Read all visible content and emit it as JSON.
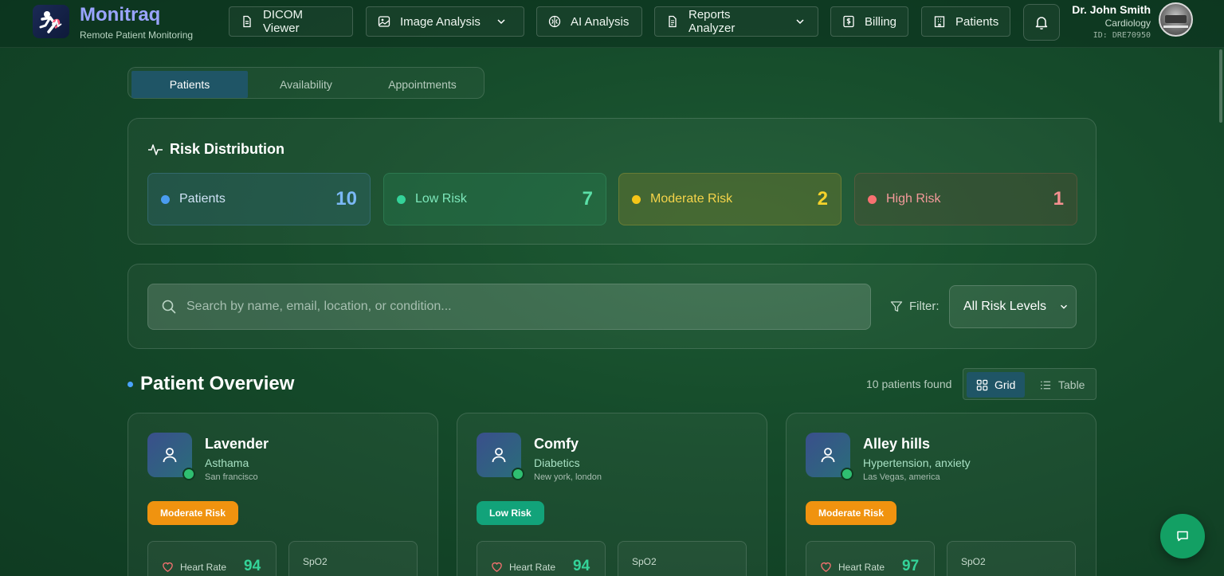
{
  "brand": {
    "title": "Monitraq",
    "subtitle": "Remote Patient Monitoring"
  },
  "nav": [
    {
      "label": "DICOM Viewer",
      "icon": "document-icon"
    },
    {
      "label": "Image Analysis",
      "icon": "image-icon"
    },
    {
      "label": "AI Analysis",
      "icon": "brain-icon"
    },
    {
      "label": "Reports Analyzer",
      "icon": "report-icon"
    },
    {
      "label": "Billing",
      "icon": "dollar-icon"
    },
    {
      "label": "Patients",
      "icon": "hospital-icon"
    }
  ],
  "user": {
    "name": "Dr. John Smith",
    "department": "Cardiology",
    "id": "ID: DRE70950"
  },
  "tabs": [
    "Patients",
    "Availability",
    "Appointments"
  ],
  "risk": {
    "title": "Risk Distribution",
    "cards": [
      {
        "label": "Patients",
        "value": "10",
        "color": "#4a9cf0"
      },
      {
        "label": "Low Risk",
        "value": "7",
        "color": "#34d399"
      },
      {
        "label": "Moderate Risk",
        "value": "2",
        "color": "#f5c518"
      },
      {
        "label": "High Risk",
        "value": "1",
        "color": "#f87171"
      }
    ]
  },
  "search": {
    "placeholder": "Search by name, email, location, or condition..."
  },
  "filter": {
    "label": "Filter:",
    "selected": "All Risk Levels"
  },
  "overview": {
    "title": "Patient Overview",
    "count": "10 patients found",
    "grid_label": "Grid",
    "table_label": "Table"
  },
  "patients": [
    {
      "name": "Lavender",
      "condition": "Asthama",
      "location": "San francisco",
      "risk": "Moderate Risk",
      "heart_rate_label": "Heart Rate",
      "heart_rate": "94",
      "spo2_label": "SpO2"
    },
    {
      "name": "Comfy",
      "condition": "Diabetics",
      "location": "New york, london",
      "risk": "Low Risk",
      "heart_rate_label": "Heart Rate",
      "heart_rate": "94",
      "spo2_label": "SpO2"
    },
    {
      "name": "Alley hills",
      "condition": "Hypertension, anxiety",
      "location": "Las Vegas, america",
      "risk": "Moderate Risk",
      "heart_rate_label": "Heart Rate",
      "heart_rate": "97",
      "spo2_label": "SpO2"
    }
  ]
}
